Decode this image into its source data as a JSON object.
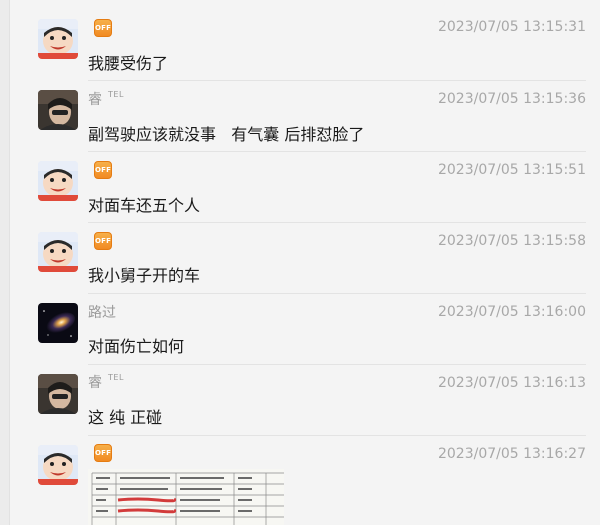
{
  "messages": [
    {
      "sender": "",
      "badge": "OFF",
      "tel": "",
      "time": "2023/07/05 13:15:31",
      "text": "我腰受伤了"
    },
    {
      "sender": "睿",
      "badge": "",
      "tel": "TEL",
      "time": "2023/07/05 13:15:36",
      "text": "副驾驶应该就没事   有气囊 后排怼脸了"
    },
    {
      "sender": "",
      "badge": "OFF",
      "tel": "",
      "time": "2023/07/05 13:15:51",
      "text": "对面车还五个人"
    },
    {
      "sender": "",
      "badge": "OFF",
      "tel": "",
      "time": "2023/07/05 13:15:58",
      "text": "我小舅子开的车"
    },
    {
      "sender": "路过",
      "badge": "",
      "tel": "",
      "time": "2023/07/05 13:16:00",
      "text": "对面伤亡如何"
    },
    {
      "sender": "睿",
      "badge": "",
      "tel": "TEL",
      "time": "2023/07/05 13:16:13",
      "text": "这 纯 正碰"
    },
    {
      "sender": "",
      "badge": "OFF",
      "tel": "",
      "time": "2023/07/05 13:16:27",
      "text": ""
    }
  ],
  "colors": {
    "background": "#f4f4f4",
    "badge_orange": "#f18a22",
    "timestamp_gray": "#a8a8a8",
    "name_gray": "#9a9a9a",
    "text_black": "#1a1a1a"
  },
  "icons": [
    "cartoon-avatar-icon",
    "person-photo-avatar-icon",
    "galaxy-avatar-icon",
    "off-badge-icon"
  ]
}
